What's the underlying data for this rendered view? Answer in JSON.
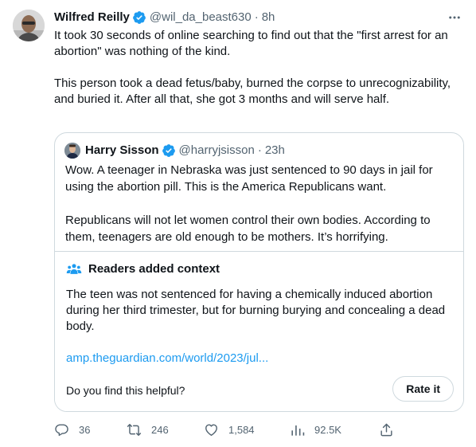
{
  "author": {
    "name": "Wilfred Reilly",
    "handle": "@wil_da_beast630",
    "time": "8h",
    "avatar_icon": "person-avatar-icon",
    "verified_icon": "verified-badge-icon"
  },
  "tweet": {
    "paragraphs": [
      "It took 30 seconds of online searching to find out that the \"first arrest for an abortion\" was nothing of the kind.",
      "This person took a dead fetus/baby, burned the corpse to unrecognizability, and buried it. After all that, she got 3 months and will serve half."
    ]
  },
  "quote": {
    "name": "Harry Sisson",
    "handle": "@harryjsisson",
    "time": "23h",
    "paragraphs": [
      "Wow. A teenager in Nebraska was just sentenced to 90 days in jail for using the abortion pill. This is the America Republicans want.",
      "Republicans will not let women control their own bodies. According to them, teenagers are old enough to be mothers. It’s horrifying."
    ]
  },
  "context": {
    "title": "Readers added context",
    "text": "The teen was not sentenced for having a chemically induced abortion during her third trimester, but for burning burying and concealing a dead body.",
    "link": "amp.theguardian.com/world/2023/jul...",
    "helpful_prompt": "Do you find this helpful?",
    "rate_label": "Rate it"
  },
  "actions": {
    "replies": "36",
    "retweets": "246",
    "likes": "1,584",
    "views": "92.5K"
  },
  "colors": {
    "text": "#0f1419",
    "secondary": "#536471",
    "accent": "#1d9bf0",
    "border": "#cfd9de"
  }
}
